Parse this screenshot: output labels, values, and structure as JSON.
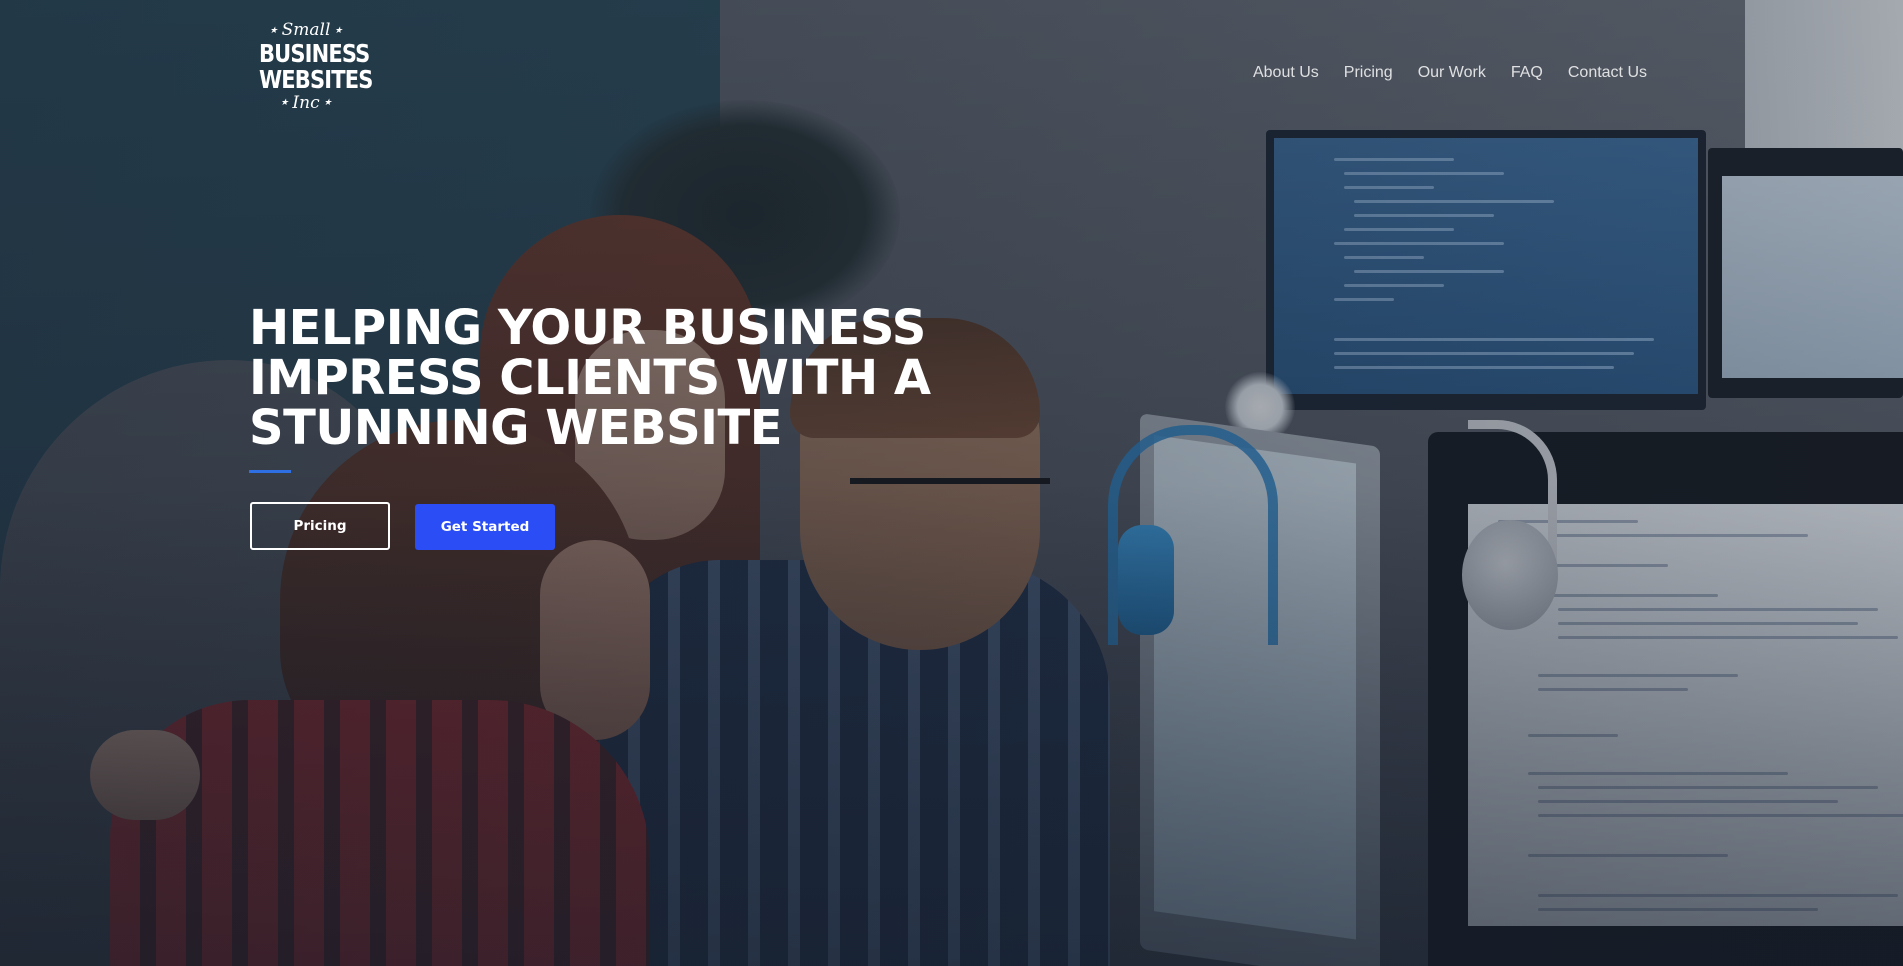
{
  "logo": {
    "top_script": "Small",
    "line1": "BUSINESS",
    "line2": "WEBSITES",
    "bottom_script": "Inc",
    "star": "★"
  },
  "nav": {
    "items": [
      {
        "label": "About Us"
      },
      {
        "label": "Pricing"
      },
      {
        "label": "Our Work"
      },
      {
        "label": "FAQ"
      },
      {
        "label": "Contact Us"
      }
    ]
  },
  "hero": {
    "headline_lines": [
      "HELPING YOUR BUSINESS",
      "IMPRESS CLIENTS WITH A",
      "STUNNING WEBSITE"
    ],
    "buttons": {
      "pricing_label": "Pricing",
      "get_started_label": "Get Started"
    }
  },
  "colors": {
    "accent_line": "#2f6fe4",
    "primary_button": "#2b4df5",
    "text": "#ffffff"
  }
}
